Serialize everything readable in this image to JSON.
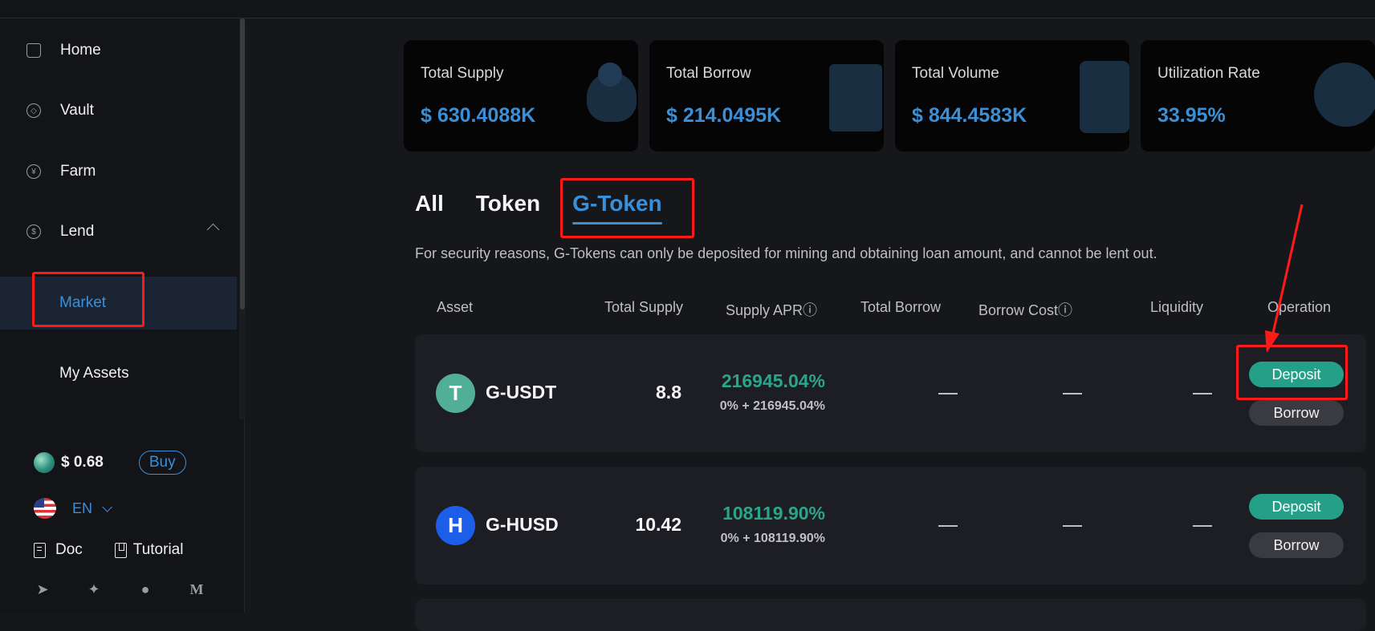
{
  "sidebar": {
    "nav": [
      {
        "label": "Home",
        "icon": "home-icon"
      },
      {
        "label": "Vault",
        "icon": "vault-icon"
      },
      {
        "label": "Farm",
        "icon": "farm-icon"
      },
      {
        "label": "Lend",
        "icon": "lend-icon"
      }
    ],
    "sub_items": [
      {
        "label": "Market",
        "active": true
      },
      {
        "label": "My Assets",
        "active": false
      }
    ],
    "price": "$ 0.68",
    "buy_label": "Buy",
    "language": "EN",
    "links": {
      "doc": "Doc",
      "tutorial": "Tutorial"
    },
    "social_icons": [
      "telegram-icon",
      "twitter-icon",
      "github-icon",
      "medium-icon"
    ]
  },
  "stats": [
    {
      "label": "Total Supply",
      "value": "$ 630.4088K"
    },
    {
      "label": "Total Borrow",
      "value": "$ 214.0495K"
    },
    {
      "label": "Total Volume",
      "value": "$ 844.4583K"
    },
    {
      "label": "Utilization Rate",
      "value": "33.95%"
    }
  ],
  "tabs": [
    "All",
    "Token",
    "G-Token"
  ],
  "active_tab": "G-Token",
  "notice": "For security reasons, G-Tokens can only be deposited for mining and obtaining loan amount, and cannot be lent out.",
  "table": {
    "headers": [
      "Asset",
      "Total Supply",
      "Supply APRⓘ",
      "Total Borrow",
      "Borrow Costⓘ",
      "Liquidity",
      "Operation"
    ],
    "rows": [
      {
        "asset": "G-USDT",
        "icon_glyph": "T",
        "icon_color": "#50af95",
        "total_supply": "8.8",
        "apr": "216945.04%",
        "apr_detail": "0% + 216945.04%",
        "deposit": "Deposit",
        "borrow": "Borrow"
      },
      {
        "asset": "G-HUSD",
        "icon_glyph": "H",
        "icon_color": "#1c5ee8",
        "total_supply": "10.42",
        "apr": "108119.90%",
        "apr_detail": "0% + 108119.90%",
        "deposit": "Deposit",
        "borrow": "Borrow"
      }
    ]
  },
  "colors": {
    "accent": "#3a8fd9",
    "positive": "#2aa58a",
    "highlight": "#ff1a1a"
  }
}
